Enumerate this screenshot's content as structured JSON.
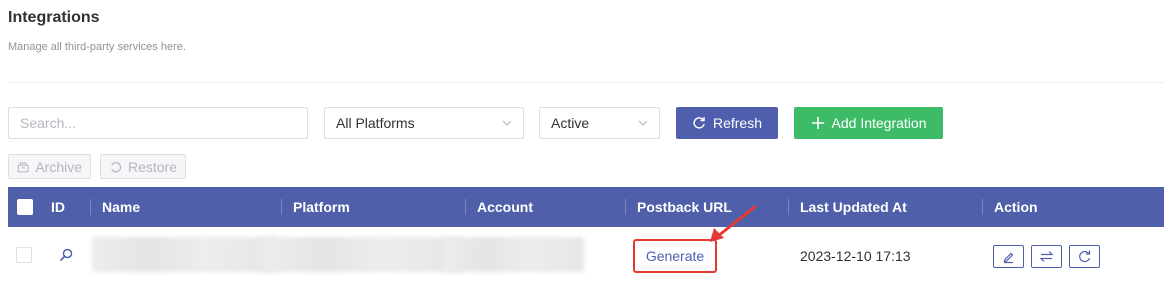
{
  "header": {
    "title": "Integrations",
    "subtitle": "Manage all third-party services here."
  },
  "toolbar": {
    "search_placeholder": "Search...",
    "platform_select": "All Platforms",
    "status_select": "Active",
    "refresh_label": "Refresh",
    "add_label": "Add Integration",
    "archive_label": "Archive",
    "restore_label": "Restore"
  },
  "table": {
    "columns": [
      "ID",
      "Name",
      "Platform",
      "Account",
      "Postback URL",
      "Last Updated At",
      "Action"
    ],
    "rows": [
      {
        "postback_action": "Generate",
        "last_updated": "2023-12-10 17:13",
        "actions": [
          "edit-icon",
          "swap-icon",
          "refresh-icon"
        ]
      }
    ]
  },
  "colors": {
    "primary": "#4f5fae",
    "success": "#3dbb66",
    "highlight": "#e53935",
    "header_bg": "#4f5fa9"
  }
}
